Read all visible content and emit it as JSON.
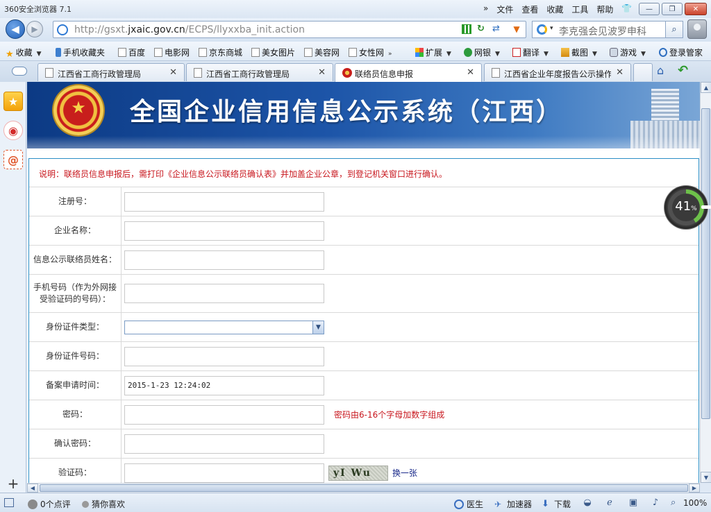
{
  "browser": {
    "title": "360安全浏览器 7.1",
    "menu": [
      "文件",
      "查看",
      "收藏",
      "工具",
      "帮助"
    ],
    "window_buttons": [
      "—",
      "❐",
      "✕"
    ]
  },
  "address_bar": {
    "url_prefix": "http://gsxt.",
    "url_host": "jxaic.gov.cn",
    "url_suffix": "/ECPS/llyxxba_init.action"
  },
  "search": {
    "text": "李克强会见波罗申科"
  },
  "favorites": [
    {
      "label": "收藏",
      "icon": "star-icon"
    },
    {
      "label": "手机收藏夹",
      "icon": "phone-icon"
    },
    {
      "label": "百度",
      "icon": "doc-icon"
    },
    {
      "label": "电影网",
      "icon": "doc-icon"
    },
    {
      "label": "京东商城",
      "icon": "doc-icon"
    },
    {
      "label": "美女图片",
      "icon": "doc-icon"
    },
    {
      "label": "美容网",
      "icon": "doc-icon"
    },
    {
      "label": "女性网",
      "icon": "doc-icon"
    }
  ],
  "toolbar_extras": [
    {
      "label": "扩展",
      "icon": "extension-icon"
    },
    {
      "label": "网银",
      "icon": "bank-icon"
    },
    {
      "label": "翻译",
      "icon": "translate-icon"
    },
    {
      "label": "截图",
      "icon": "screenshot-icon"
    },
    {
      "label": "游戏",
      "icon": "game-icon"
    },
    {
      "label": "登录管家",
      "icon": "login-manager-icon"
    }
  ],
  "tabs": [
    {
      "label": "江西省工商行政管理局",
      "active": false
    },
    {
      "label": "江西省工商行政管理局",
      "active": false
    },
    {
      "label": "联络员信息申报",
      "active": true
    },
    {
      "label": "江西省企业年度报告公示操作",
      "active": false
    }
  ],
  "page": {
    "banner_title": "全国企业信用信息公示系统（江西）",
    "notice": "说明：联络员信息申报后，需打印《企业信息公示联络员确认表》并加盖企业公章，到登记机关窗口进行确认。",
    "fields": {
      "reg_no": {
        "label": "注册号："
      },
      "company_name": {
        "label": "企业名称："
      },
      "contact_name": {
        "label": "信息公示联络员姓名："
      },
      "mobile": {
        "label": "手机号码（作为外网接受验证码的号码）："
      },
      "id_type": {
        "label": "身份证件类型："
      },
      "id_number": {
        "label": "身份证件号码："
      },
      "apply_time": {
        "label": "备案申请时间：",
        "value": "2015-1-23 12:24:02"
      },
      "password": {
        "label": "密码：",
        "hint": "密码由6-16个字母加数字组成"
      },
      "confirm_password": {
        "label": "确认密码："
      },
      "captcha": {
        "label": "验证码：",
        "image_text": "yI Wu",
        "refresh": "换一张"
      }
    }
  },
  "progress": {
    "value": 41,
    "unit": "%"
  },
  "status_bar": {
    "comments": "0个点评",
    "guess": "猜你喜欢",
    "doctor": "医生",
    "accelerator": "加速器",
    "download": "下载",
    "zoom": "100%"
  }
}
